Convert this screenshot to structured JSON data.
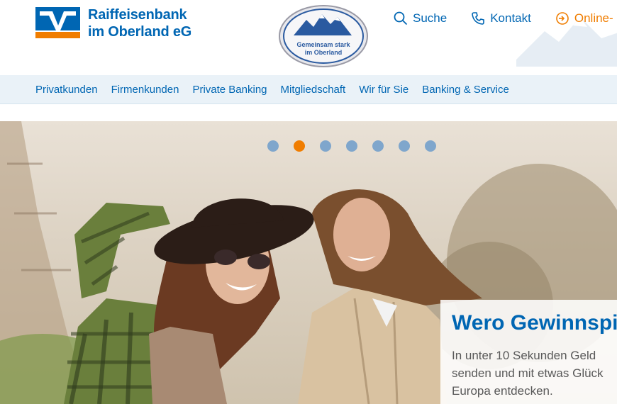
{
  "bank": {
    "name_line1": "Raiffeisenbank",
    "name_line2": "im Oberland eG",
    "brand_blue": "#0066b3",
    "brand_orange": "#f07d00"
  },
  "seal": {
    "line1": "Gemeinsam stark",
    "line2": "im Oberland"
  },
  "top_links": [
    {
      "label": "Suche",
      "icon": "search-icon"
    },
    {
      "label": "Kontakt",
      "icon": "phone-icon"
    },
    {
      "label": "Online-",
      "icon": "login-icon"
    }
  ],
  "nav": {
    "items": [
      "Privatkunden",
      "Firmenkunden",
      "Private Banking",
      "Mitgliedschaft",
      "Wir für Sie",
      "Banking & Service"
    ]
  },
  "carousel": {
    "slide_count": 7,
    "active_index": 1
  },
  "teaser": {
    "title": "Wero Gewinnspi",
    "text_line1": "In unter 10 Sekunden Geld",
    "text_line2": "senden und mit etwas Glück",
    "text_line3": "Europa entdecken."
  }
}
